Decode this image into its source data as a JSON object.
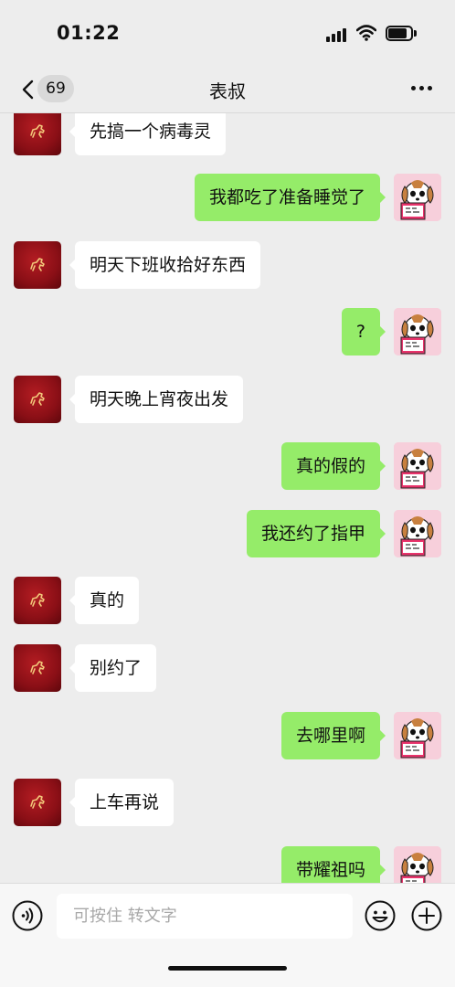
{
  "status_bar": {
    "time": "01:22"
  },
  "header": {
    "back_badge": "69",
    "title": "表叔"
  },
  "messages": [
    {
      "side": "in",
      "text": "先搞一个病毒灵"
    },
    {
      "side": "out",
      "text": "我都吃了准备睡觉了"
    },
    {
      "side": "in",
      "text": "明天下班收拾好东西"
    },
    {
      "side": "out",
      "text": "?"
    },
    {
      "side": "in",
      "text": "明天晚上宵夜出发"
    },
    {
      "side": "out",
      "text": "真的假的"
    },
    {
      "side": "out",
      "text": "我还约了指甲"
    },
    {
      "side": "in",
      "text": "真的"
    },
    {
      "side": "in",
      "text": "别约了"
    },
    {
      "side": "out",
      "text": "去哪里啊"
    },
    {
      "side": "in",
      "text": "上车再说"
    },
    {
      "side": "out",
      "text": "带耀祖吗"
    }
  ],
  "input_bar": {
    "placeholder": "可按住 转文字"
  },
  "icons": {
    "back": "chevron-left-icon",
    "more": "more-dots-icon",
    "voice": "voice-icon",
    "emoji": "emoji-icon",
    "plus": "plus-icon",
    "contact_avatar": "red-horse-avatar",
    "self_avatar": "cartoon-dog-avatar"
  },
  "colors": {
    "background": "#ededed",
    "outgoing_bubble": "#95ec69",
    "incoming_bubble": "#ffffff",
    "contact_avatar": "#9a1219"
  }
}
